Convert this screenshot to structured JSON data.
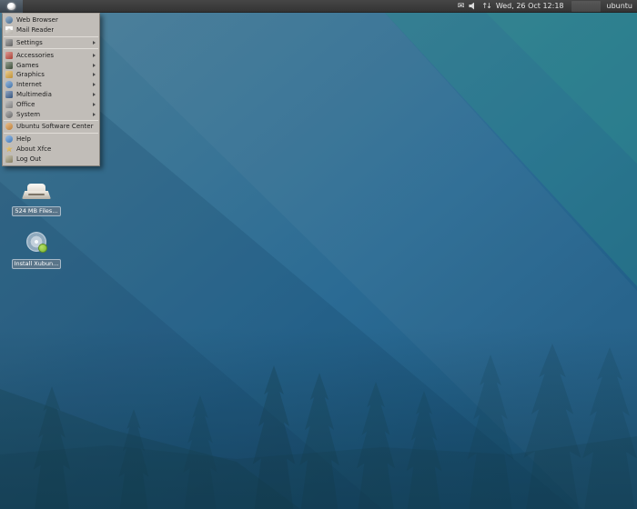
{
  "panel": {
    "clock": "Wed, 26 Oct 12:18",
    "username": "ubuntu",
    "mail_glyph": "✉",
    "network_glyph": "↑↓"
  },
  "menu": {
    "items": [
      {
        "label": "Web Browser",
        "icon": "web-browser-icon",
        "color": "#4e7ba6",
        "shape": "circle",
        "submenu": false
      },
      {
        "label": "Mail Reader",
        "icon": "mail-reader-icon",
        "color": "#cfcbc3",
        "shape": "envelope",
        "submenu": false
      },
      {
        "type": "separator"
      },
      {
        "label": "Settings",
        "icon": "settings-icon",
        "color": "#6e6e6e",
        "shape": "square",
        "submenu": true
      },
      {
        "type": "separator"
      },
      {
        "label": "Accessories",
        "icon": "accessories-icon",
        "color": "#c04a3e",
        "shape": "square",
        "submenu": true
      },
      {
        "label": "Games",
        "icon": "games-icon",
        "color": "#46573f",
        "shape": "square",
        "submenu": true
      },
      {
        "label": "Graphics",
        "icon": "graphics-icon",
        "color": "#d9a43c",
        "shape": "square",
        "submenu": true
      },
      {
        "label": "Internet",
        "icon": "internet-icon",
        "color": "#4a82c0",
        "shape": "circle",
        "submenu": true
      },
      {
        "label": "Multimedia",
        "icon": "multimedia-icon",
        "color": "#3c5f90",
        "shape": "square",
        "submenu": true
      },
      {
        "label": "Office",
        "icon": "office-icon",
        "color": "#8f8f8f",
        "shape": "square",
        "submenu": true
      },
      {
        "label": "System",
        "icon": "system-icon",
        "color": "#787878",
        "shape": "circle",
        "submenu": true
      },
      {
        "type": "separator"
      },
      {
        "label": "Ubuntu Software Center",
        "icon": "software-center-icon",
        "color": "#d78f3c",
        "shape": "circle",
        "submenu": false
      },
      {
        "type": "separator"
      },
      {
        "label": "Help",
        "icon": "help-icon",
        "color": "#4a8ad2",
        "shape": "circle",
        "submenu": false
      },
      {
        "label": "About Xfce",
        "icon": "about-xfce-icon",
        "color": "#e3b23e",
        "shape": "star",
        "submenu": false
      },
      {
        "label": "Log Out",
        "icon": "log-out-icon",
        "color": "#9a9270",
        "shape": "square",
        "submenu": false
      }
    ]
  },
  "desktop_icons": [
    {
      "label": "524 MB Files...",
      "kind": "drive"
    },
    {
      "label": "Install Xubun...",
      "kind": "cdrom"
    }
  ],
  "colors": {
    "panel_bg": "#3d3d3d",
    "menu_bg": "#c1bdb8",
    "wallpaper_top_left": "#4a7d97",
    "wallpaper_teal": "#2f8b84",
    "wallpaper_bottom": "#1d5a82",
    "tree_silhouette": "#16414f",
    "icon_label_bg": "#5d768a"
  }
}
